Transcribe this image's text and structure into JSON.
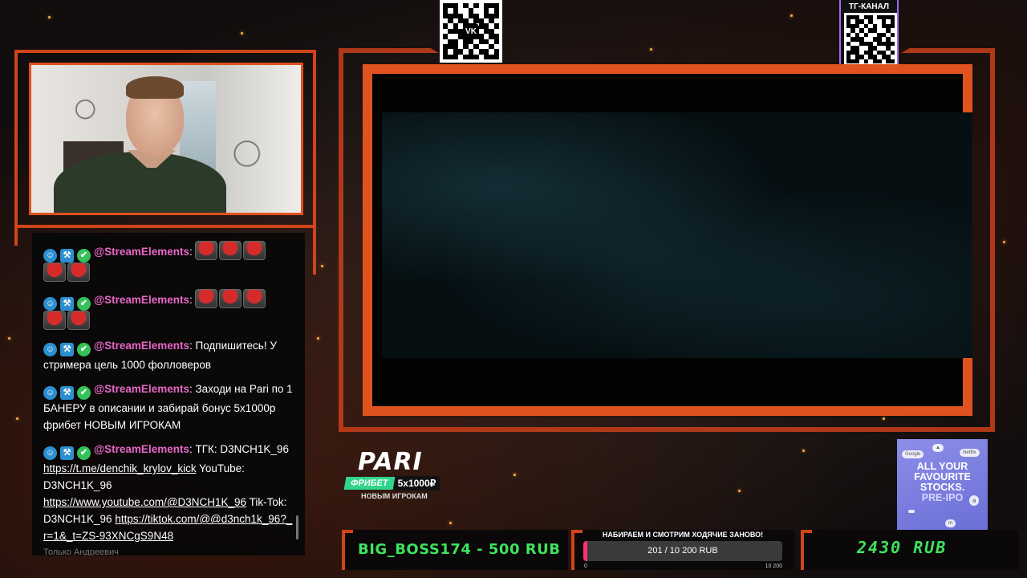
{
  "qr_vk": {
    "logo": "VK"
  },
  "qr_tg": {
    "label": "ТГ-КАНАЛ"
  },
  "chat": {
    "messages": [
      {
        "user": "@StreamElements",
        "text": "",
        "emotes": 5
      },
      {
        "user": "@StreamElements",
        "text": "",
        "emotes": 5
      },
      {
        "user": "@StreamElements",
        "text": "Подпишитесь! У стримера цель 1000 фолловеров",
        "emotes": 0
      },
      {
        "user": "@StreamElements",
        "text": "Заходи на Pari по 1 БАНЕРУ в описании и забирай бонус 5x1000р фрибет НОВЫМ ИГРОКАМ",
        "emotes": 0
      }
    ],
    "last": {
      "user": "@StreamElements",
      "t1": "ТГК: D3NCH1K_96",
      "link1": "https://t.me/denchik_krylov_kick",
      "t2": "YouTube: D3NCH1K_96",
      "link2": "https://www.youtube.com/@D3NCH1K_96",
      "t3": "Tik-Tok: D3NCH1K_96",
      "link3": "https://tiktok.com/@@d3nch1k_96?_r=1&_t=ZS-93XNCgS9N48"
    },
    "cut_text": "Только Андреевич"
  },
  "pari": {
    "logo": "PARI",
    "freebet": "ФРИБЕТ",
    "amount": "5x1000₽",
    "new_players": "НОВЫМ ИГРОКАМ"
  },
  "ad": {
    "line1": "ALL YOUR",
    "line2": "FAVOURITE",
    "line3": "STOCKS.",
    "line4": "PRE-IPO",
    "chip1": "Google",
    "chip2": "Netflix"
  },
  "donation": {
    "text": "BIG_BOSS174 - 500 RUB"
  },
  "goal": {
    "title": "НАБИРАЕМ И СМОТРИМ ХОДЯЧИЕ ЗАНОВО!",
    "value_text": "201 / 10 200 RUB",
    "min": "0",
    "max": "10 200",
    "progress": 0.0197
  },
  "total": {
    "text": "2430  RUB"
  }
}
